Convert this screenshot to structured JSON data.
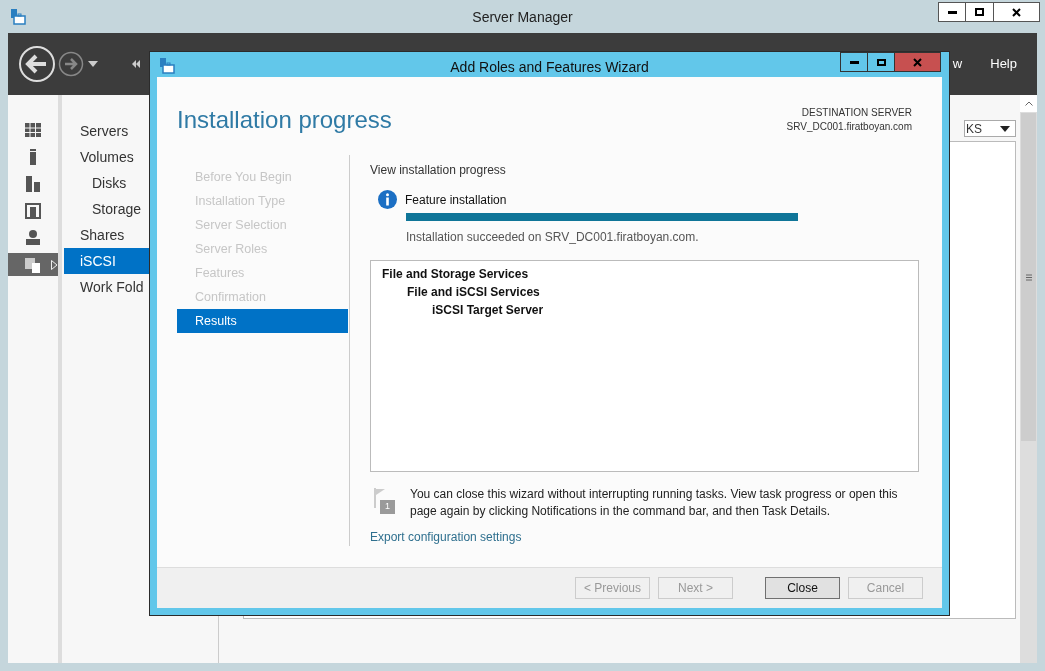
{
  "server_manager": {
    "title": "Server Manager",
    "toolbar": {
      "menu_items": [
        "w",
        "Help"
      ]
    },
    "nav_icons": [
      {
        "kind": "grid",
        "selected": false
      },
      {
        "kind": "server",
        "selected": false
      },
      {
        "kind": "servers",
        "selected": false
      },
      {
        "kind": "group",
        "selected": false
      },
      {
        "kind": "storage",
        "selected": false
      },
      {
        "kind": "files",
        "selected": true
      }
    ],
    "nav_items": [
      {
        "label": "Servers",
        "selected": false
      },
      {
        "label": "Volumes",
        "selected": false,
        "children": [
          {
            "label": "Disks",
            "selected": false
          },
          {
            "label": "Storage",
            "selected": false
          }
        ]
      },
      {
        "label": "Shares",
        "selected": false
      },
      {
        "label": "iSCSI",
        "selected": true
      },
      {
        "label": "Work Fold",
        "selected": false
      }
    ],
    "tasks_dropdown": "KS"
  },
  "wizard": {
    "title": "Add Roles and Features Wizard",
    "heading": "Installation progress",
    "destination_label": "DESTINATION SERVER",
    "destination_server": "SRV_DC001.firatboyan.com",
    "steps": [
      {
        "label": "Before You Begin",
        "selected": false
      },
      {
        "label": "Installation Type",
        "selected": false
      },
      {
        "label": "Server Selection",
        "selected": false
      },
      {
        "label": "Server Roles",
        "selected": false
      },
      {
        "label": "Features",
        "selected": false
      },
      {
        "label": "Confirmation",
        "selected": false
      },
      {
        "label": "Results",
        "selected": true
      }
    ],
    "section_title": "View installation progress",
    "progress": {
      "label": "Feature installation",
      "level": 1,
      "status": "Installation succeeded on SRV_DC001.firatboyan.com."
    },
    "results": [
      {
        "label": "File and Storage Services",
        "children": [
          {
            "label": "File and iSCSI Services",
            "children": [
              {
                "label": "iSCSI Target Server"
              }
            ]
          }
        ]
      }
    ],
    "note_count": "1",
    "note": "You can close this wizard without interrupting running tasks. View task progress or open this page again by clicking Notifications in the command bar, and then Task Details.",
    "link": "Export configuration settings",
    "buttons": [
      {
        "label": "< Previous",
        "disabled": true,
        "default": false
      },
      {
        "label": "Next >",
        "disabled": true,
        "default": false
      },
      {
        "label": "Close",
        "disabled": false,
        "default": true
      },
      {
        "label": "Cancel",
        "disabled": true,
        "default": false
      }
    ]
  }
}
